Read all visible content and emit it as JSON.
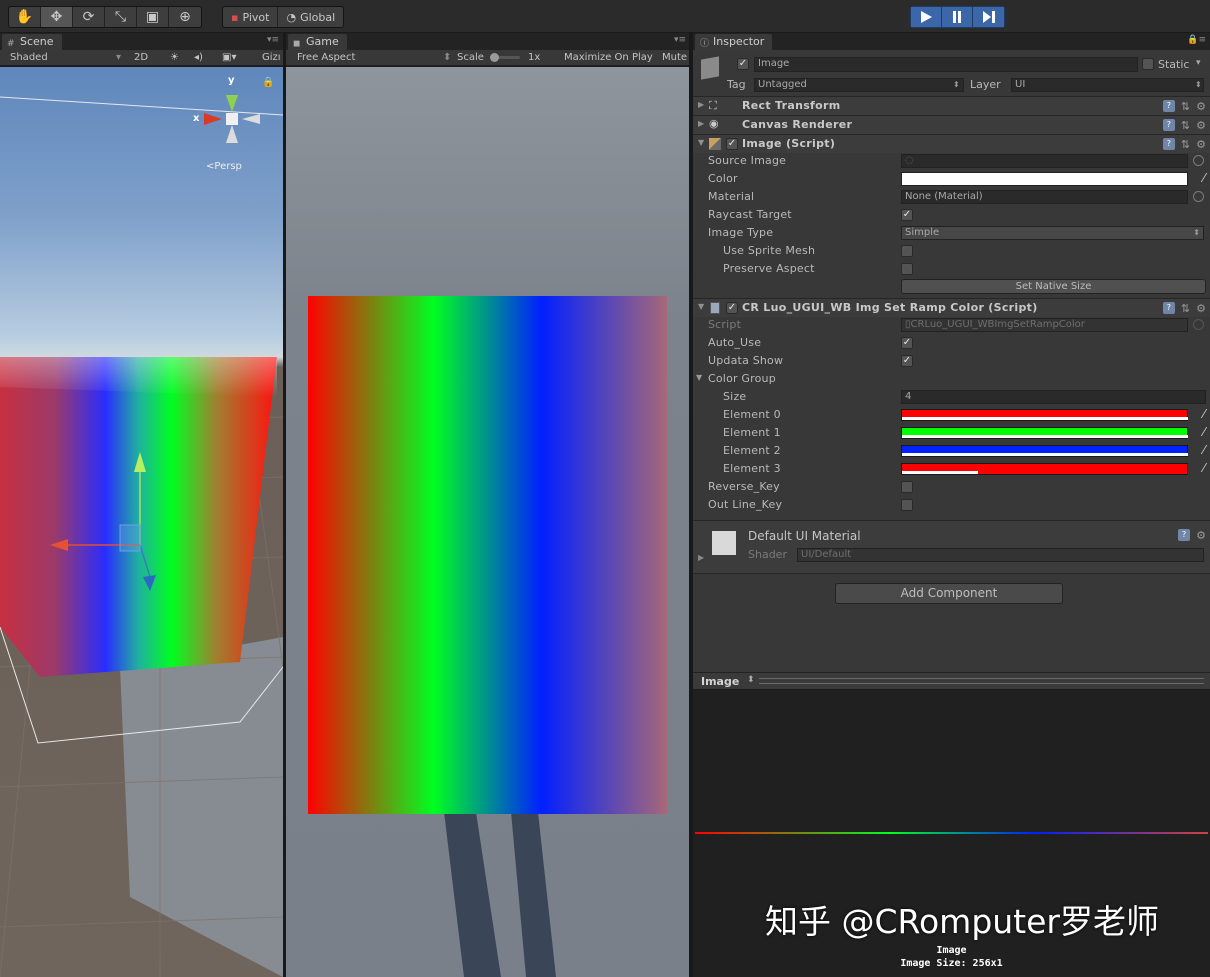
{
  "toolbar": {
    "pivot_label": "Pivot",
    "global_label": "Global"
  },
  "scene": {
    "tab_label": "Scene",
    "shading": "Shaded",
    "mode_2d": "2D",
    "gizmos": "Gizı",
    "persp": "Persp",
    "axis_y": "y",
    "axis_x": "x"
  },
  "game": {
    "tab_label": "Game",
    "aspect": "Free Aspect",
    "scale_label": "Scale",
    "scale_value": "1x",
    "maximize": "Maximize On Play",
    "mute": "Mute"
  },
  "inspector": {
    "tab_label": "Inspector",
    "object_name": "Image",
    "static_label": "Static",
    "tag_label": "Tag",
    "tag_value": "Untagged",
    "layer_label": "Layer",
    "layer_value": "UI",
    "rect_transform": "Rect Transform",
    "canvas_renderer": "Canvas Renderer",
    "image_script": {
      "title": "Image (Script)",
      "source_image": "Source Image",
      "color": "Color",
      "color_value": "#ffffff",
      "material": "Material",
      "material_value": "None (Material)",
      "raycast_target": "Raycast Target",
      "image_type": "Image Type",
      "image_type_value": "Simple",
      "use_sprite_mesh": "Use Sprite Mesh",
      "preserve_aspect": "Preserve Aspect",
      "set_native_size": "Set Native Size"
    },
    "ramp_script": {
      "title": "CR Luo_UGUI_WB Img Set Ramp Color (Script)",
      "script_label": "Script",
      "script_value": "CRLuo_UGUI_WBImgSetRampColor",
      "auto_use": "Auto_Use",
      "updata_show": "Updata Show",
      "color_group": "Color Group",
      "size_label": "Size",
      "size_value": "4",
      "elements": [
        {
          "label": "Element 0",
          "color": "#ff0000"
        },
        {
          "label": "Element 1",
          "color": "#00ff00"
        },
        {
          "label": "Element 2",
          "color": "#0022ff"
        },
        {
          "label": "Element 3",
          "color": "#ff0000"
        }
      ],
      "reverse_key": "Reverse_Key",
      "outline_key": "Out Line_Key"
    },
    "material": {
      "name": "Default UI Material",
      "shader_label": "Shader",
      "shader_value": "UI/Default"
    },
    "add_component": "Add Component"
  },
  "preview": {
    "header": "Image",
    "watermark": "知乎 @CRomputer罗老师",
    "caption_name": "Image",
    "caption_size": "Image Size: 256x1"
  }
}
